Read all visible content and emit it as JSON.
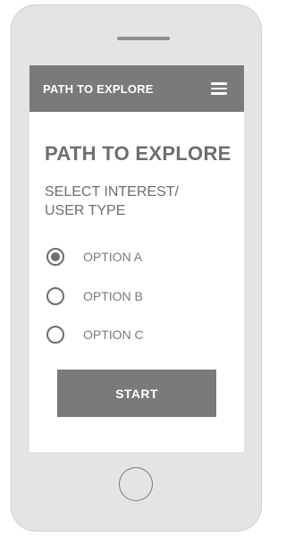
{
  "appbar": {
    "title": "PATH TO EXPLORE",
    "menu_icon": "hamburger-menu-icon"
  },
  "main": {
    "heading": "PATH TO EXPLORE",
    "subheading_lines": [
      "SELECT INTEREST/",
      "USER TYPE"
    ],
    "options": [
      {
        "label": "OPTION A",
        "selected": true
      },
      {
        "label": "OPTION B",
        "selected": false
      },
      {
        "label": "OPTION C",
        "selected": false
      }
    ],
    "start_label": "START"
  },
  "device": {
    "home_button_icon": "home-button-icon"
  },
  "colors": {
    "frame": "#e4e4e4",
    "bar": "#7a7a7a",
    "text": "#6e6e6e",
    "screen": "#ffffff"
  }
}
